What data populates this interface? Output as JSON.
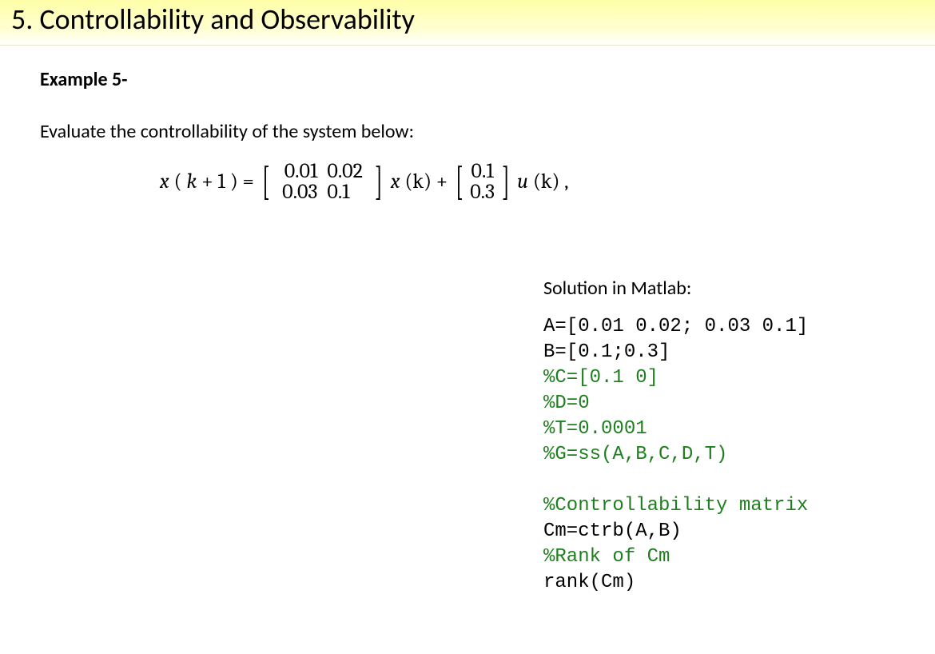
{
  "header": {
    "title": "5. Controllability and Observability"
  },
  "example": {
    "label": "Example 5-",
    "prompt": "Evaluate the controllability of the system below:"
  },
  "equation": {
    "lhs_var": "x",
    "lhs_arg_open": "(",
    "lhs_k": "k",
    "lhs_plus": " + 1",
    "lhs_arg_close": ") =",
    "A": {
      "r1c1": "0.01",
      "r1c2": "0.02",
      "r2c1": "0.03",
      "r2c2": "0.1"
    },
    "mid_var": "x",
    "mid_arg": "(k) +",
    "B": {
      "r1": "0.1",
      "r2": "0.3"
    },
    "rhs_var": "u",
    "rhs_arg": "(k) ,"
  },
  "solution": {
    "title": "Solution in Matlab:",
    "lines": [
      {
        "cls": "blk",
        "text": "A=[0.01 0.02; 0.03 0.1]"
      },
      {
        "cls": "blk",
        "text": "B=[0.1;0.3]"
      },
      {
        "cls": "grn",
        "text": "%C=[0.1 0]"
      },
      {
        "cls": "grn",
        "text": "%D=0"
      },
      {
        "cls": "grn",
        "text": "%T=0.0001"
      },
      {
        "cls": "grn",
        "text": "%G=ss(A,B,C,D,T)"
      },
      {
        "cls": "blank",
        "text": ""
      },
      {
        "cls": "grn",
        "text": "%Controllability matrix"
      },
      {
        "cls": "blk",
        "text": "Cm=ctrb(A,B)"
      },
      {
        "cls": "grn",
        "text": "%Rank of Cm"
      },
      {
        "cls": "blk",
        "text": "rank(Cm)"
      }
    ]
  }
}
